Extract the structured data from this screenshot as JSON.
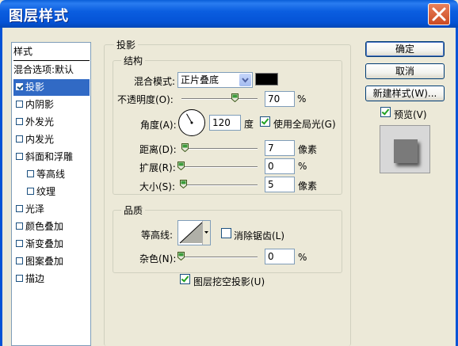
{
  "window": {
    "title": "图层样式",
    "close_icon": "close-icon"
  },
  "style_list": {
    "header": "样式",
    "blend_options": "混合选项:默认",
    "items": [
      {
        "label": "投影",
        "checked": true,
        "selected": true
      },
      {
        "label": "内阴影",
        "checked": false
      },
      {
        "label": "外发光",
        "checked": false
      },
      {
        "label": "内发光",
        "checked": false
      },
      {
        "label": "斜面和浮雕",
        "checked": false
      },
      {
        "label": "等高线",
        "checked": false
      },
      {
        "label": "纹理",
        "checked": false
      },
      {
        "label": "光泽",
        "checked": false
      },
      {
        "label": "颜色叠加",
        "checked": false
      },
      {
        "label": "渐变叠加",
        "checked": false
      },
      {
        "label": "图案叠加",
        "checked": false
      },
      {
        "label": "描边",
        "checked": false
      }
    ]
  },
  "shadow": {
    "section_title": "投影",
    "structure_title": "结构",
    "blend_mode_label": "混合模式:",
    "blend_mode_value": "正片叠底",
    "shadow_color": "#000000",
    "opacity_label": "不透明度(O):",
    "opacity_value": "70",
    "opacity_unit": "%",
    "opacity_fraction": 0.7,
    "angle_label": "角度(A):",
    "angle_value": "120",
    "angle_unit": "度",
    "global_light_label": "使用全局光(G)",
    "global_light_checked": true,
    "distance_label": "距离(D):",
    "distance_value": "7",
    "distance_unit": "像素",
    "spread_label": "扩展(R):",
    "spread_value": "0",
    "spread_unit": "%",
    "size_label": "大小(S):",
    "size_value": "5",
    "size_unit": "像素",
    "quality_title": "品质",
    "contour_label": "等高线:",
    "antialias_label": "消除锯齿(L)",
    "antialias_checked": false,
    "noise_label": "杂色(N):",
    "noise_value": "0",
    "noise_unit": "%",
    "knockout_label": "图层挖空投影(U)",
    "knockout_checked": true
  },
  "buttons": {
    "ok": "确定",
    "cancel": "取消",
    "new_style": "新建样式(W)...",
    "preview_label": "预览(V)",
    "preview_checked": true
  }
}
